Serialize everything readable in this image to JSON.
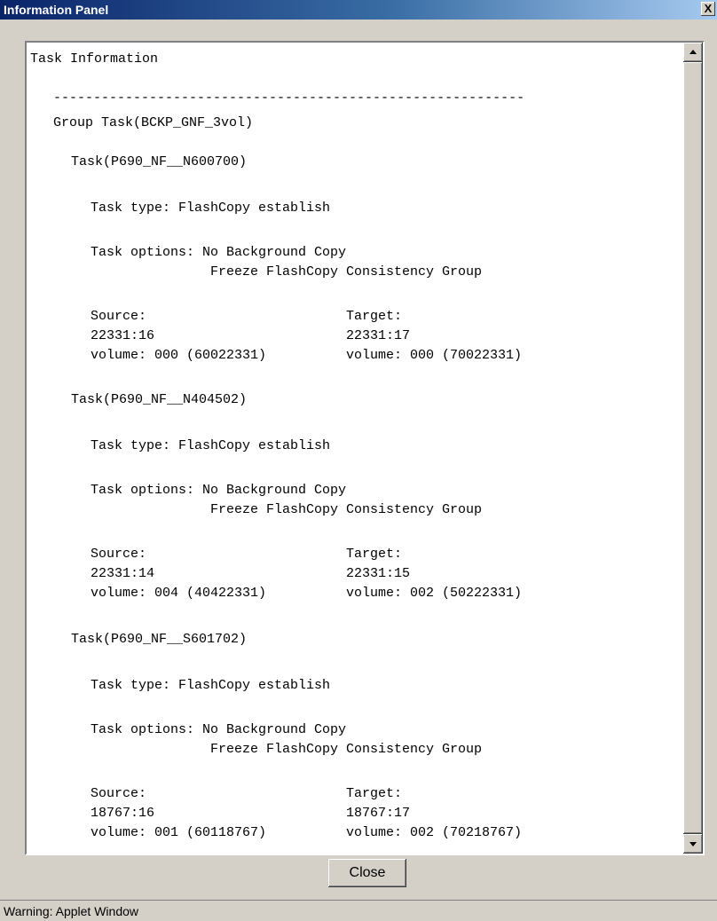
{
  "window": {
    "title": "Information Panel",
    "close_glyph": "X"
  },
  "panel": {
    "lines": [
      "Task Information",
      "-----------------------------------------------------------",
      "Group Task(BCKP_GNF_3vol)",
      "Task(P690_NF__N600700)",
      "Task type: FlashCopy establish",
      "Task options: No Background Copy",
      "Freeze FlashCopy Consistency Group",
      "Source:",
      "Target:",
      "22331:16",
      "22331:17",
      "volume: 000 (60022331)",
      "volume: 000 (70022331)",
      "Task(P690_NF__N404502)",
      "Task type: FlashCopy establish",
      "Task options: No Background Copy",
      "Freeze FlashCopy Consistency Group",
      "Source:",
      "Target:",
      "22331:14",
      "22331:15",
      "volume: 004 (40422331)",
      "volume: 002 (50222331)",
      "Task(P690_NF__S601702)",
      "Task type: FlashCopy establish",
      "Task options: No Background Copy",
      "Freeze FlashCopy Consistency Group",
      "Source:",
      "Target:",
      "18767:16",
      "18767:17",
      "volume: 001 (60118767)",
      "volume: 002 (70218767)"
    ]
  },
  "scrollbar": {
    "up_icon": "arrow-up-icon",
    "down_icon": "arrow-down-icon"
  },
  "buttons": {
    "close_label": "Close"
  },
  "status": {
    "text": "Warning: Applet Window"
  }
}
